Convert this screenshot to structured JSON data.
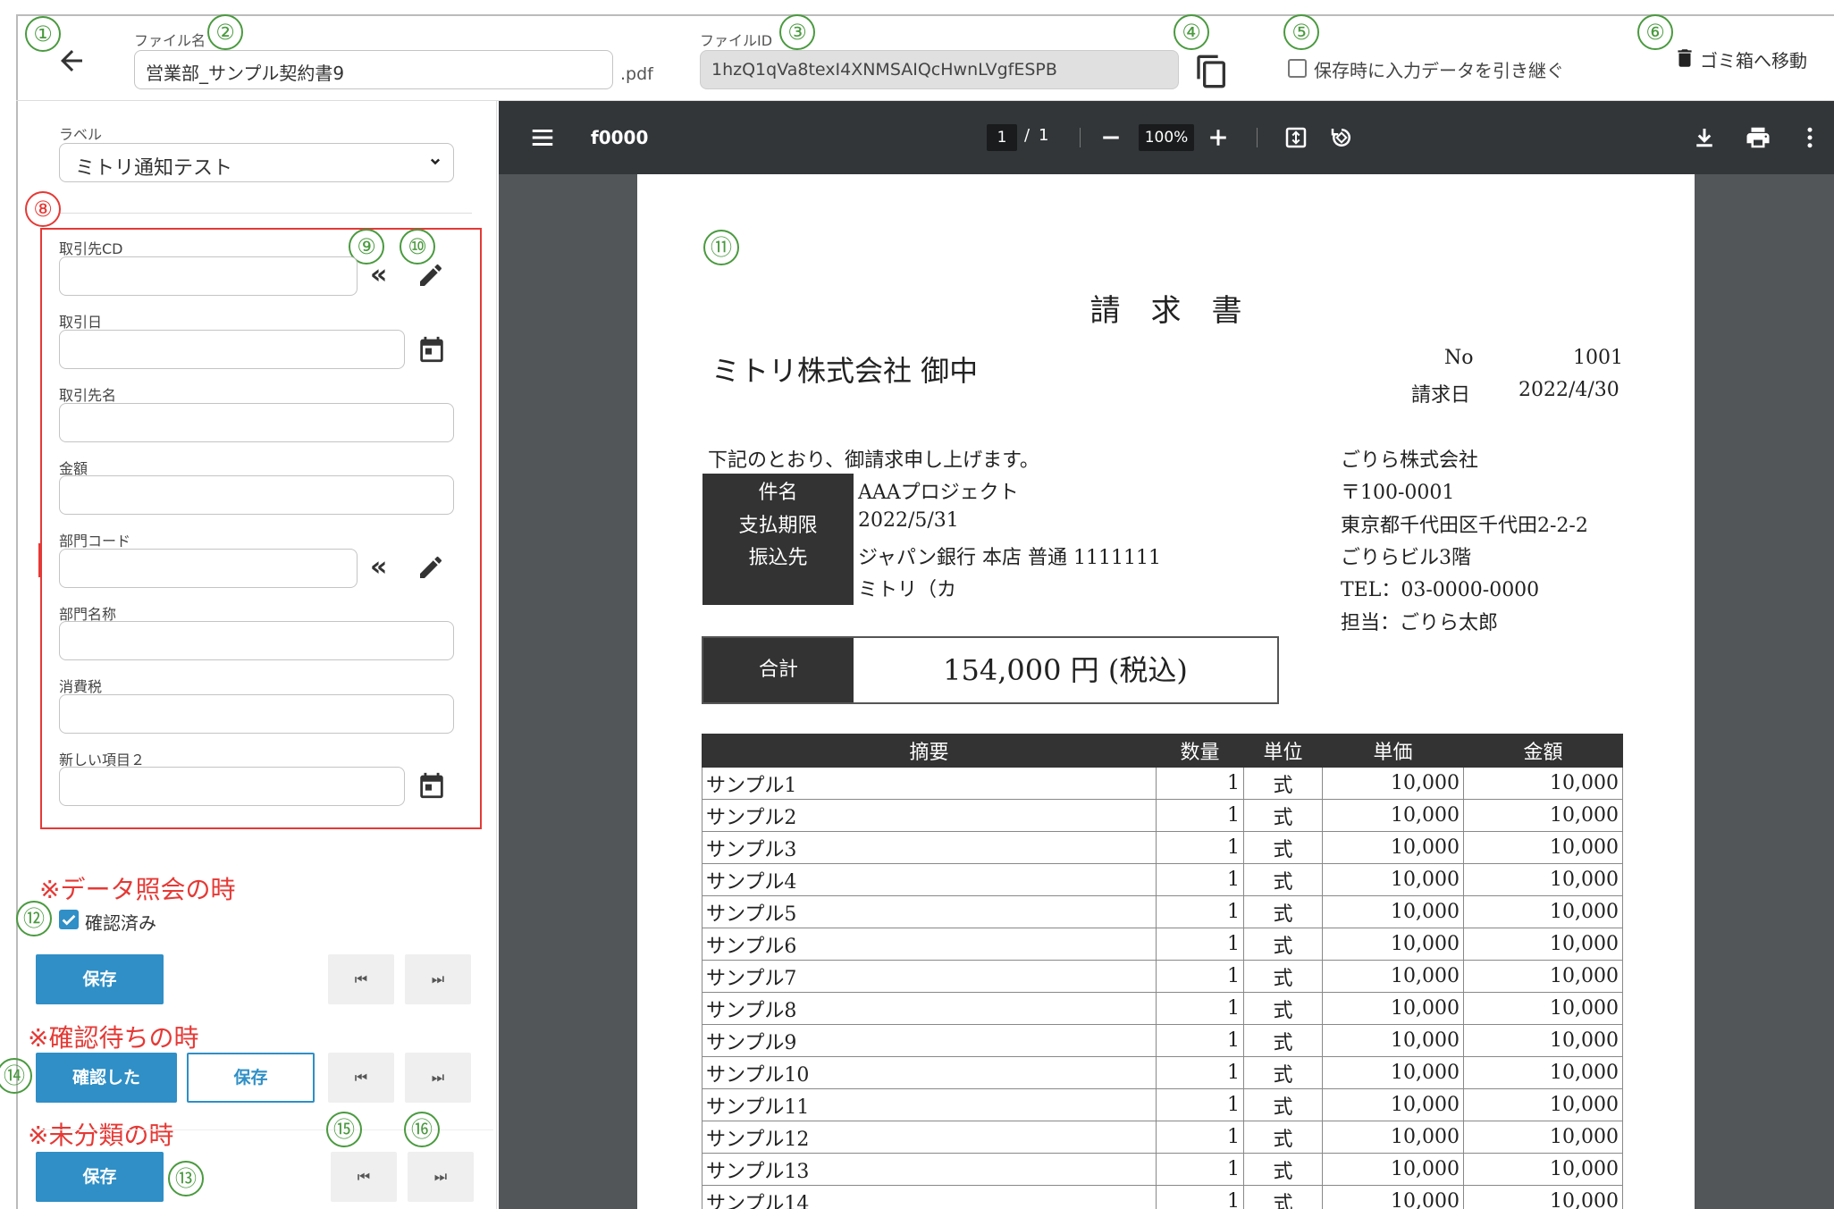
{
  "header": {
    "filename_label": "ファイル名",
    "filename_value": "営業部_サンプル契約書9",
    "extension": ".pdf",
    "fileid_label": "ファイルID",
    "fileid_value": "1hzQ1qVa8texI4XNMSAIQcHwnLVgfESPB",
    "carry_over_label": "保存時に入力データを引き継ぐ",
    "trash_label": "ゴミ箱へ移動"
  },
  "markers": [
    "①",
    "②",
    "③",
    "④",
    "⑤",
    "⑥",
    "⑧",
    "⑨",
    "⑩",
    "⑪",
    "⑫",
    "⑬",
    "⑭",
    "⑮",
    "⑯"
  ],
  "sidebar": {
    "label_caption": "ラベル",
    "label_selected": "ミトリ通知テスト",
    "fields": [
      {
        "label": "取引先CD"
      },
      {
        "label": "取引日"
      },
      {
        "label": "取引先名"
      },
      {
        "label": "金額"
      },
      {
        "label": "部門コード"
      },
      {
        "label": "部門名称"
      },
      {
        "label": "消費税"
      },
      {
        "label": "新しい項目２"
      }
    ],
    "note_data_query": "※データ照会の時",
    "confirmed_label": "確認済み",
    "save_label": "保存",
    "note_pending": "※確認待ちの時",
    "confirm_label": "確認した",
    "note_unclassified": "※未分類の時"
  },
  "pdf_viewer": {
    "filename": "f0000",
    "page_current": "1",
    "page_sep": "/",
    "page_total": "1",
    "zoom": "100%"
  },
  "invoice": {
    "title": "請　求　書",
    "recipient": "ミトリ株式会社 御中",
    "no_label": "No",
    "no_value": "1001",
    "date_label": "請求日",
    "date_value": "2022/4/30",
    "intro": "下記のとおり、御請求申し上げます。",
    "info": [
      {
        "k": "件名",
        "v": "AAAプロジェクト"
      },
      {
        "k": "支払期限",
        "v": "2022/5/31"
      },
      {
        "k": "振込先",
        "v": "ジャパン銀行 本店 普通 1111111"
      },
      {
        "k": "",
        "v": "ミトリ（カ"
      }
    ],
    "issuer": [
      "ごりら株式会社",
      "〒100-0001",
      "東京都千代田区千代田2-2-2",
      "ごりらビル3階",
      "TEL：03-0000-0000",
      "担当：ごりら太郎"
    ],
    "total_label": "合計",
    "total_value": "154,000 円 (税込)",
    "columns": [
      "摘要",
      "数量",
      "単位",
      "単価",
      "金額"
    ],
    "rows": [
      [
        "サンプル1",
        "1",
        "式",
        "10,000",
        "10,000"
      ],
      [
        "サンプル2",
        "1",
        "式",
        "10,000",
        "10,000"
      ],
      [
        "サンプル3",
        "1",
        "式",
        "10,000",
        "10,000"
      ],
      [
        "サンプル4",
        "1",
        "式",
        "10,000",
        "10,000"
      ],
      [
        "サンプル5",
        "1",
        "式",
        "10,000",
        "10,000"
      ],
      [
        "サンプル6",
        "1",
        "式",
        "10,000",
        "10,000"
      ],
      [
        "サンプル7",
        "1",
        "式",
        "10,000",
        "10,000"
      ],
      [
        "サンプル8",
        "1",
        "式",
        "10,000",
        "10,000"
      ],
      [
        "サンプル9",
        "1",
        "式",
        "10,000",
        "10,000"
      ],
      [
        "サンプル10",
        "1",
        "式",
        "10,000",
        "10,000"
      ],
      [
        "サンプル11",
        "1",
        "式",
        "10,000",
        "10,000"
      ],
      [
        "サンプル12",
        "1",
        "式",
        "10,000",
        "10,000"
      ],
      [
        "サンプル13",
        "1",
        "式",
        "10,000",
        "10,000"
      ],
      [
        "サンプル14",
        "1",
        "式",
        "10,000",
        "10,000"
      ]
    ]
  }
}
